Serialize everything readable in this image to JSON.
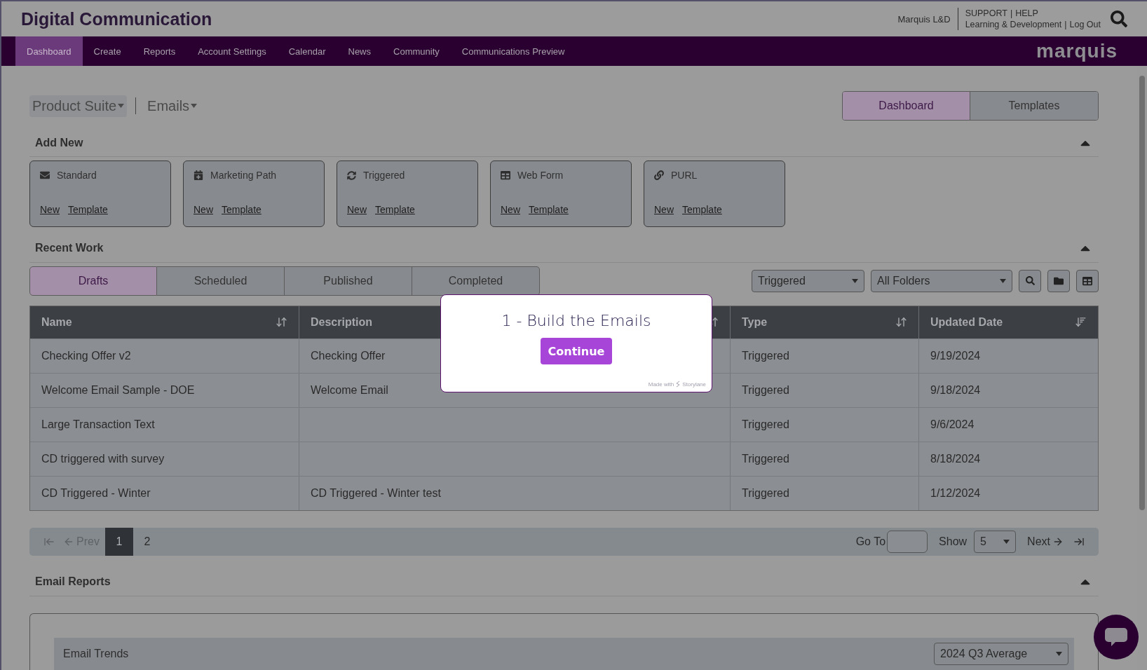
{
  "header": {
    "title": "Digital Communication",
    "user": "Marquis L&D",
    "links_top": [
      "SUPPORT",
      "HELP"
    ],
    "links_bottom": [
      "Learning & Development",
      "Log Out"
    ],
    "separator": "|"
  },
  "nav": {
    "items": [
      {
        "label": "Dashboard",
        "selected": true
      },
      {
        "label": "Create",
        "selected": false
      },
      {
        "label": "Reports",
        "selected": false
      },
      {
        "label": "Account Settings",
        "selected": false
      },
      {
        "label": "Calendar",
        "selected": false
      },
      {
        "label": "News",
        "selected": false
      },
      {
        "label": "Community",
        "selected": false
      },
      {
        "label": "Communications Preview",
        "selected": false
      }
    ],
    "brand": "marquis"
  },
  "breadcrumb": [
    {
      "label": "Product Suite",
      "selected": true
    },
    {
      "label": "Emails",
      "selected": false
    }
  ],
  "view_toggle": [
    {
      "label": "Dashboard",
      "selected": true
    },
    {
      "label": "Templates",
      "selected": false
    }
  ],
  "add_new": {
    "title": "Add New",
    "expanded": true,
    "cards": [
      {
        "kind": "envelope",
        "label": "Standard",
        "links": [
          "New",
          "Template"
        ]
      },
      {
        "kind": "calendar",
        "label": "Marketing Path",
        "links": [
          "New",
          "Template"
        ]
      },
      {
        "kind": "refresh",
        "label": "Triggered",
        "links": [
          "New",
          "Template"
        ]
      },
      {
        "kind": "table",
        "label": "Web Form",
        "links": [
          "New",
          "Template"
        ]
      },
      {
        "kind": "link",
        "label": "PURL",
        "links": [
          "New",
          "Template"
        ]
      }
    ]
  },
  "recent_work": {
    "title": "Recent Work",
    "expanded": true,
    "tabs": [
      {
        "label": "Drafts",
        "selected": true
      },
      {
        "label": "Scheduled",
        "selected": false
      },
      {
        "label": "Published",
        "selected": false
      },
      {
        "label": "Completed",
        "selected": false
      }
    ],
    "filters": [
      "Triggered",
      "All Folders"
    ],
    "table": {
      "columns": [
        {
          "label": "Name",
          "sorted": false
        },
        {
          "label": "Description",
          "sorted": false
        },
        {
          "label": "Type",
          "sorted": false
        },
        {
          "label": "Updated Date",
          "sorted": true
        }
      ],
      "rows": [
        {
          "name": "Checking Offer v2",
          "description": "Checking Offer",
          "type": "Triggered",
          "updated": "9/19/2024"
        },
        {
          "name": "Welcome Email Sample - DOE",
          "description": "Welcome Email",
          "type": "Triggered",
          "updated": "9/18/2024"
        },
        {
          "name": "Large Transaction Text",
          "type": "Triggered",
          "updated": "9/6/2024"
        },
        {
          "name": "CD triggered with survey",
          "type": "Triggered",
          "updated": "8/18/2024"
        },
        {
          "name": "CD Triggered - Winter",
          "description": "CD Triggered - Winter test",
          "type": "Triggered",
          "updated": "1/12/2024"
        }
      ]
    },
    "pagination": {
      "prev": {
        "label": "Prev",
        "disabled": true
      },
      "pages": [
        {
          "label": "1",
          "selected": true
        },
        {
          "label": "2",
          "selected": false
        }
      ],
      "goto_label": "Go To",
      "show_label": "Show",
      "show_value": "5",
      "next": {
        "label": "Next",
        "disabled": false
      }
    }
  },
  "email_reports": {
    "title": "Email Reports",
    "expanded": true,
    "panel_title": "Email Trends",
    "period": "2024 Q3 Average"
  },
  "modal": {
    "title": "1 - Build the Emails",
    "button": "Continue",
    "credit": "Made with",
    "credit_brand": "Storylane"
  }
}
